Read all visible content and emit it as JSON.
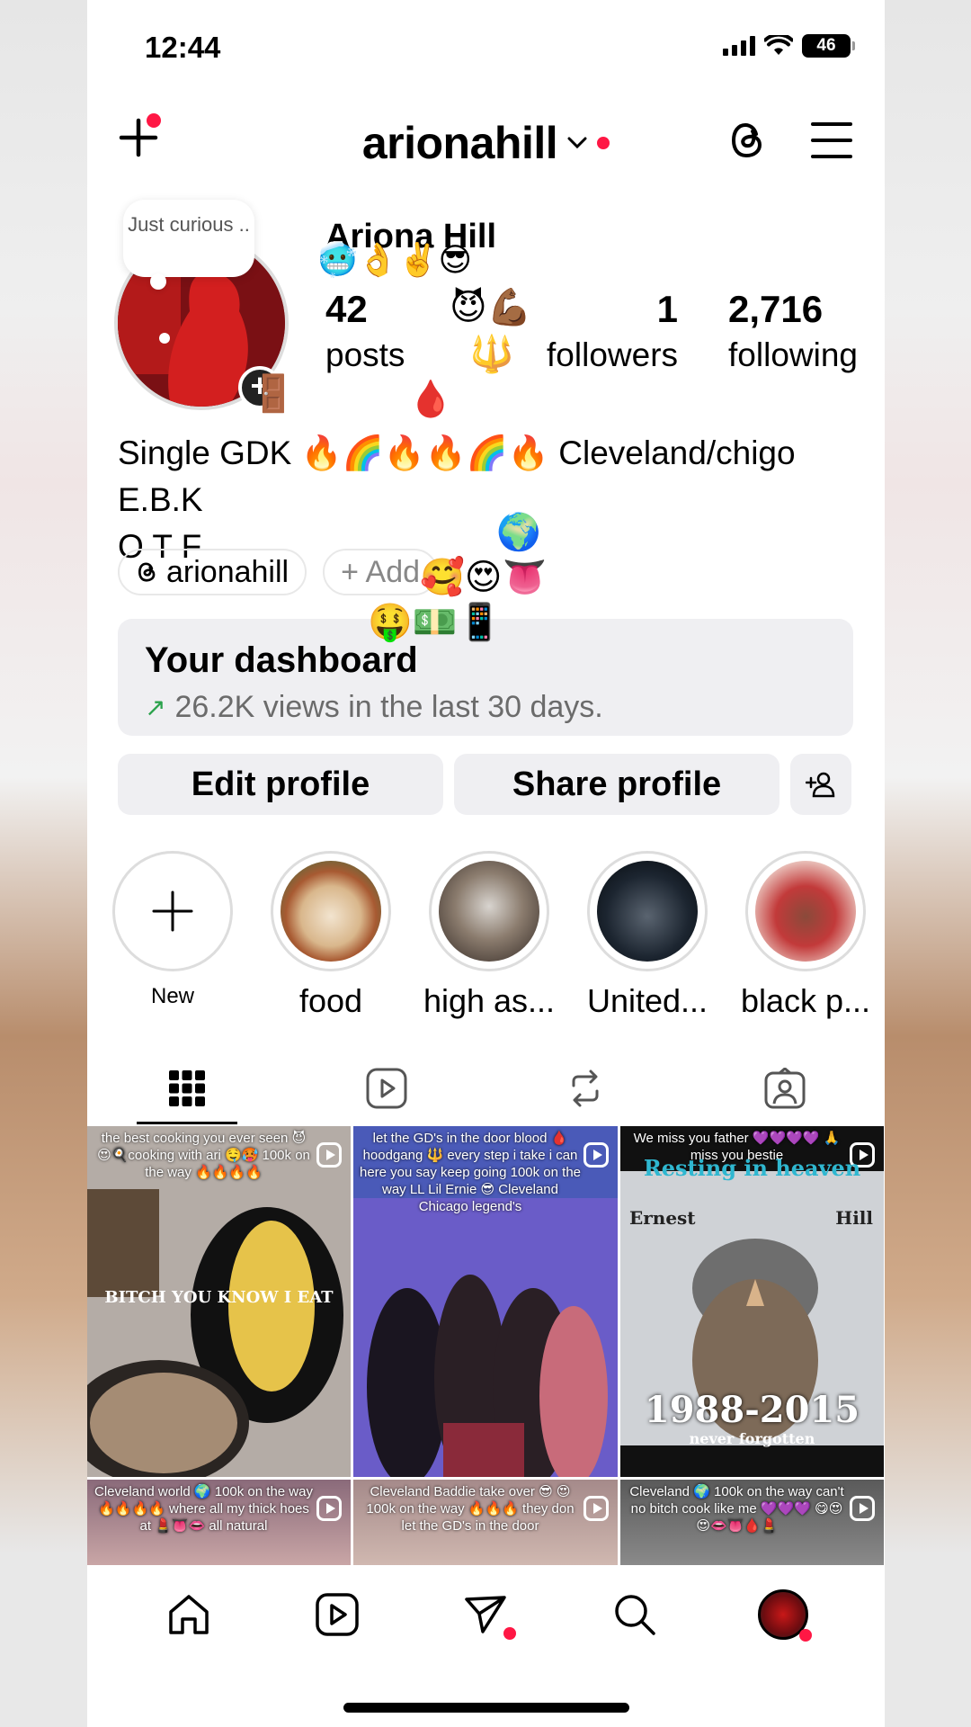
{
  "status": {
    "time": "12:44",
    "battery": "46"
  },
  "header": {
    "username": "arionahill",
    "chevron": "⌄"
  },
  "profile": {
    "note": "Just curious ..",
    "full_name": "Ariona Hill",
    "name_emojis": "🥶👌✌️😎",
    "stats": {
      "posts": {
        "num": "42",
        "label": "posts"
      },
      "followers": {
        "num": "1",
        "label": "followers"
      },
      "following": {
        "num": "2,716",
        "label": "following"
      }
    },
    "bio_line1": "Single GDK 🔥🌈🔥🔥🌈🔥 Cleveland/chigo E.B.K",
    "bio_line2": "O T F",
    "overlay_emojis": {
      "devil": "😈💪🏾",
      "trident": "🔱",
      "drop": "🩸",
      "globe": "🌍",
      "faces": "🥰😍👅",
      "money": "🤑💵📱",
      "door": "🚪"
    }
  },
  "chips": {
    "threads": "arionahill",
    "add": "+ Add"
  },
  "dashboard": {
    "title": "Your dashboard",
    "arrow": "↗",
    "subtitle": "26.2K views in the last 30 days."
  },
  "buttons": {
    "edit": "Edit profile",
    "share": "Share profile"
  },
  "highlights": [
    {
      "label": "New",
      "plus": "+"
    },
    {
      "label": "food",
      "color": "#b8a48a"
    },
    {
      "label": "high as...",
      "color": "#8b7c6e"
    },
    {
      "label": "United...",
      "color": "#1c2530"
    },
    {
      "label": "black p...",
      "color": "#c23a3a"
    }
  ],
  "grid": [
    {
      "caption": "the best cooking you ever seen 😈 😍🍳cooking with ari 🤤🥵 100k on the way 🔥🔥🔥🔥",
      "overlay": "BITCH YOU KNOW I EAT"
    },
    {
      "caption": "let the GD's in the door blood 🩸 hoodgang 🔱 every step i take i can here you say keep going 100k on the way LL Lil Ernie 😎 Cleveland Chicago legend's"
    },
    {
      "caption": "We miss you father 💜💜💜💜 🙏 miss you bestie",
      "overlay_top": "Resting in heaven",
      "name_left": "Ernest",
      "name_right": "Hill",
      "years": "1988-2015",
      "footer": "never forgotten"
    },
    {
      "caption": "Cleveland world 🌍 100k on the way 🔥🔥🔥🔥 where all my thick hoes at 💄👅👄 all natural"
    },
    {
      "caption": "Cleveland Baddie take over 😎 😍100k on the way 🔥🔥🔥 they don let the GD's in the door"
    },
    {
      "caption": "Cleveland 🌍 100k on the way can't no bitch cook like me 💜💜💜 😋😍😍👄👅🩸💄"
    }
  ]
}
